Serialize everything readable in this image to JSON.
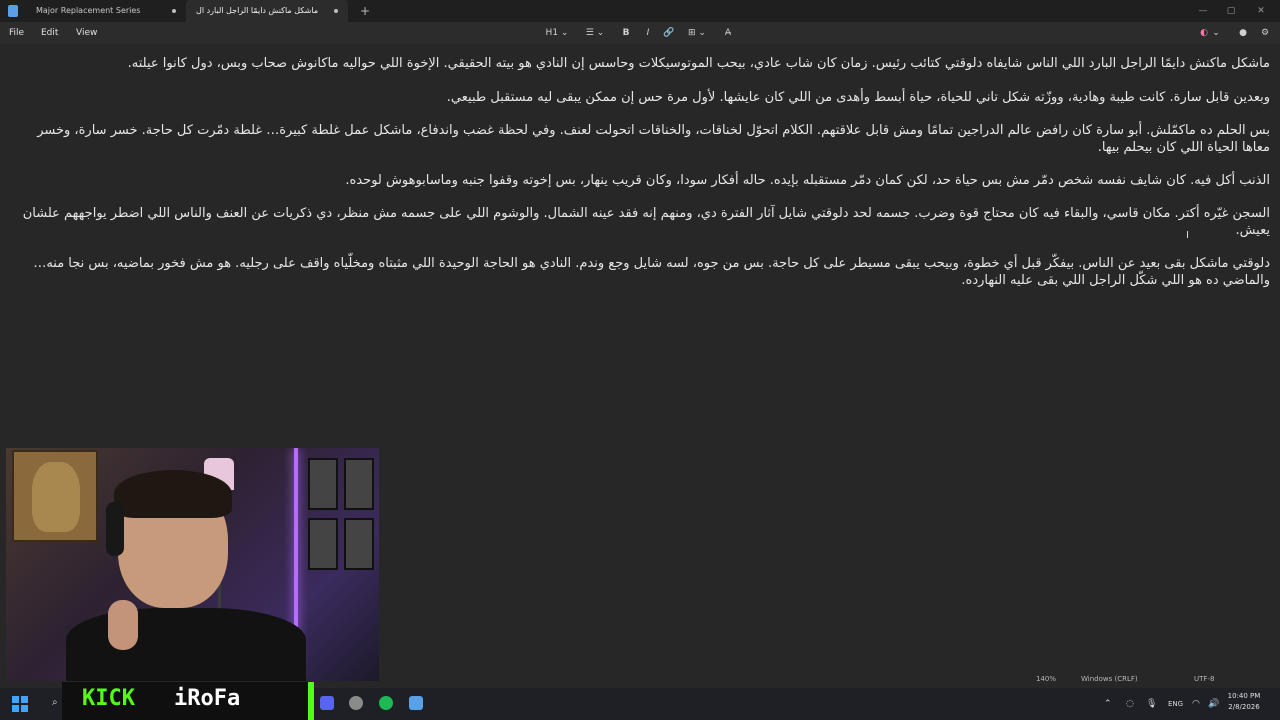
{
  "window": {
    "tabs": [
      {
        "label": "Major Replacement Series"
      },
      {
        "label": "ماشكل ماكنش دايمًا الراجل البارد ال"
      }
    ],
    "new_tab_symbol": "+",
    "controls": {
      "minimize": "—",
      "maximize": "▢",
      "close": "✕"
    }
  },
  "menu": {
    "items": [
      "File",
      "Edit",
      "View"
    ],
    "heading": "H1",
    "list": "☰",
    "bold": "B",
    "italic": "I",
    "link": "🔗",
    "table": "⊞",
    "clear": "A̶"
  },
  "document": {
    "paragraphs": [
      "ماشكل ماكنش دايمًا الراجل البارد اللي الناس شايفاه دلوقتي كتائب رئيس. زمان كان شاب عادي، بيحب الموتوسيكلات وحاسس إن النادي هو بيته الحقيقي. الإخوة اللي حواليه ماكانوش صحاب وبس، دول كانوا عيلته.",
      "وبعدين قابل سارة. كانت طيبة وهادية، ووزّته شكل تاني للحياة، حياة أبسط وأهدى من اللي كان عايشها. لأول مرة حس إن ممكن يبقى ليه مستقبل طبيعي.",
      "بس الحلم ده ماكمّلش. أبو سارة كان رافض عالم الدراجين تمامًا ومش قابل علاقتهم. الكلام اتحوّل لخناقات، والخناقات اتحولت لعنف. وفي لحظة غضب واندفاع، ماشكل عمل غلطة كبيرة… غلطة دمّرت كل حاجة. خسر سارة، وخسر معاها الحياة اللي كان بيحلم بيها.",
      "الذنب أكل فيه. كان شايف نفسه شخص دمّر مش بس حياة حد، لكن كمان دمّر مستقبله بإيده. حاله أفكار سودا، وكان قريب ينهار، بس إخوته وقفوا جنبه وماسابوهوش لوحده.",
      "السجن غيّره أكتر. مكان قاسي، والبقاء فيه كان محتاج قوة وضرب. جسمه لحد دلوقتي شايل آثار الفترة دي، ومنهم إنه فقد عينه الشمال. والوشوم اللي على جسمه مش منظر، دي ذكريات عن العنف والناس اللي اضطر يواجههم علشان يعيش.",
      "دلوقتي ماشكل بقى بعيد عن الناس. بيفكّر قبل أي خطوة، وبيحب يبقى مسيطر على كل حاجة. بس من جوه، لسه شايل وجع وندم. النادي هو الحاجة الوحيدة اللي مثبتاه ومخلّياه واقف على رجليه. هو مش فخور بماضيه، بس نجا منه… والماضي ده هو اللي شكّل الراجل اللي بقى عليه النهارده."
    ]
  },
  "statusbar": {
    "zoom": "140%",
    "line_endings": "Windows (CRLF)",
    "encoding": "UTF-8"
  },
  "overlay": {
    "platform": "KICK",
    "streamer": "iRoFa"
  },
  "taskbar": {
    "language": "ENG",
    "time": "10:40 PM",
    "date": "2/8/2026",
    "tray_up": "⌃"
  },
  "colors": {
    "kick_green": "#53fc18",
    "neon_purple": "#b56cff",
    "editor_bg": "#272727"
  }
}
